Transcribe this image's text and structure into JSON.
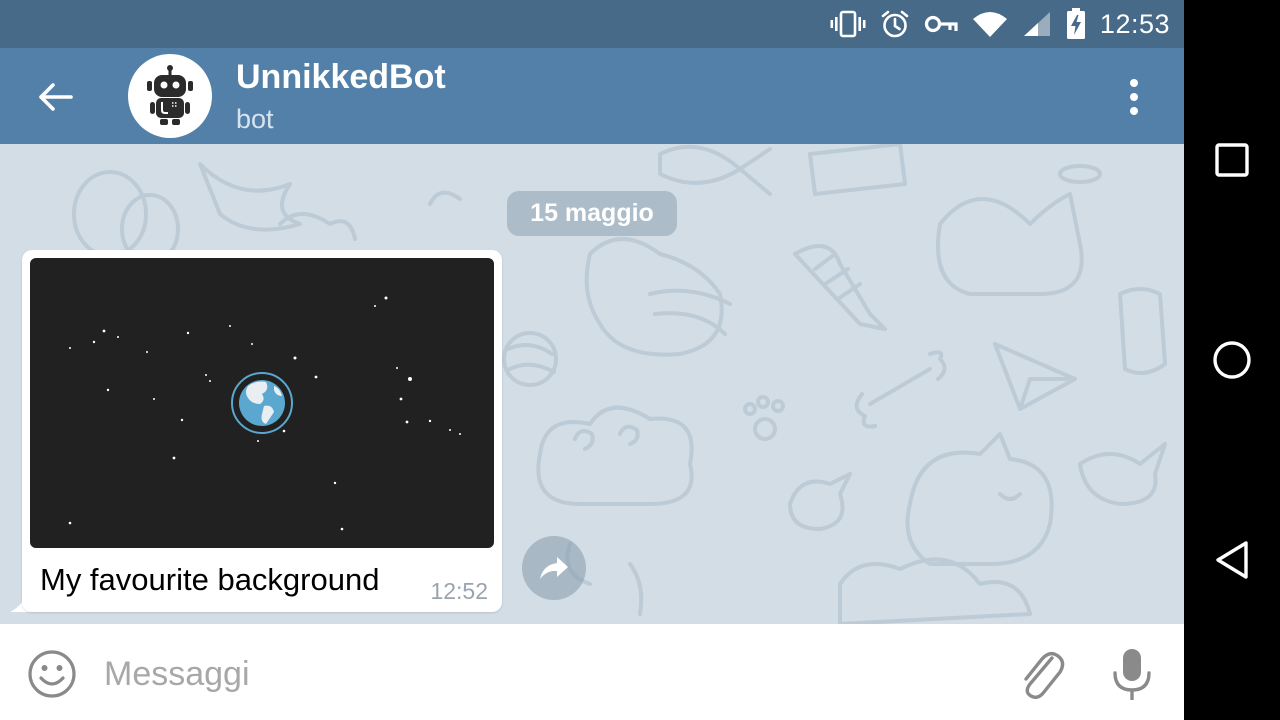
{
  "status_bar": {
    "time": "12:53",
    "icons": [
      "vibrate-icon",
      "alarm-icon",
      "vpn-key-icon",
      "wifi-icon",
      "signal-icon",
      "battery-charging-icon"
    ]
  },
  "header": {
    "title": "UnnikkedBot",
    "subtitle": "bot",
    "colors": {
      "bar": "#5280a8",
      "status": "#466a87"
    }
  },
  "chat": {
    "date_label": "15 maggio",
    "messages": [
      {
        "caption": "My favourite background",
        "time": "12:52",
        "media": "space-earth-image"
      }
    ]
  },
  "input": {
    "placeholder": "Messaggi"
  },
  "nav": {
    "buttons": [
      "recents-button",
      "home-button",
      "back-button"
    ]
  }
}
